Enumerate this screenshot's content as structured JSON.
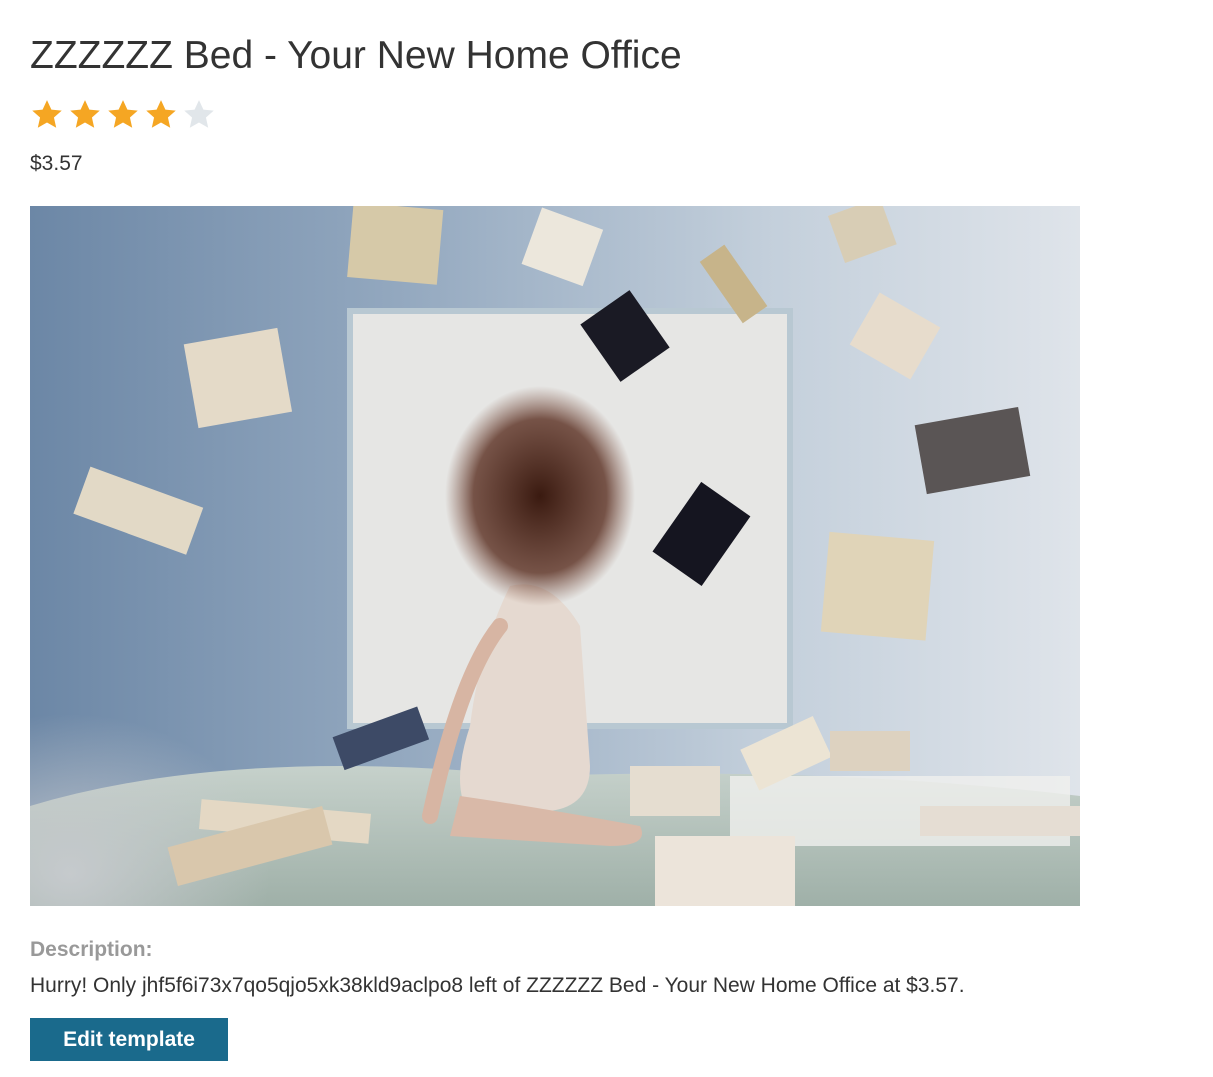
{
  "product": {
    "title": "ZZZZZZ Bed - Your New Home Office",
    "rating": 4,
    "rating_max": 5,
    "price": "$3.57",
    "image_alt": "Woman sitting on a bed with books flying around her",
    "description_label": "Description:",
    "description": "Hurry! Only jhf5f6i73x7qo5qjo5xk38kld9aclpo8 left of ZZZZZZ Bed - Your New Home Office at $3.57."
  },
  "actions": {
    "edit_label": "Edit template"
  },
  "colors": {
    "star_filled": "#f5a623",
    "star_empty": "#e1e6ea",
    "button_bg": "#1a6a8c",
    "label_gray": "#999999",
    "text": "#333333"
  }
}
